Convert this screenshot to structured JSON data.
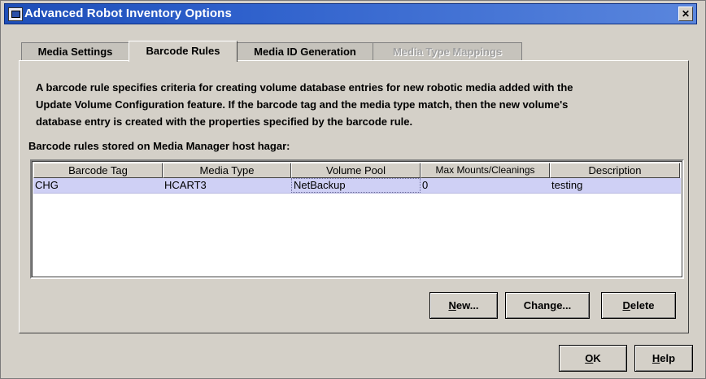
{
  "window": {
    "title": "Advanced Robot Inventory Options",
    "close_symbol": "✕"
  },
  "tabs": [
    {
      "label": "Media Settings",
      "state": "normal"
    },
    {
      "label": "Barcode Rules",
      "state": "active"
    },
    {
      "label": "Media ID Generation",
      "state": "normal"
    },
    {
      "label": "Media Type Mappings",
      "state": "disabled"
    }
  ],
  "description_lines": [
    "A barcode rule specifies criteria for creating volume database entries for new robotic media added with the",
    "Update Volume Configuration feature.  If the barcode tag and the media type match, then the new volume's",
    "database entry is created with the properties specified by the barcode rule."
  ],
  "rules_label": "Barcode rules stored on Media Manager host hagar:",
  "table": {
    "columns": [
      "Barcode Tag",
      "Media Type",
      "Volume Pool",
      "Max Mounts/Cleanings",
      "Description"
    ],
    "rows": [
      [
        "CHG",
        "HCART3",
        "NetBackup",
        "0",
        "testing"
      ]
    ]
  },
  "buttons": {
    "new_mn": "N",
    "new_rest": "ew...",
    "change_pre": "Chan",
    "change_mn": "g",
    "change_rest": "e...",
    "delete_mn": "D",
    "delete_rest": "elete",
    "ok_mn": "O",
    "ok_rest": "K",
    "help_mn": "H",
    "help_rest": "elp"
  },
  "colors": {
    "title_bar": "#2f61cc",
    "selected_row": "#cfd0f5",
    "dialog_bg": "#d4d0c8"
  }
}
